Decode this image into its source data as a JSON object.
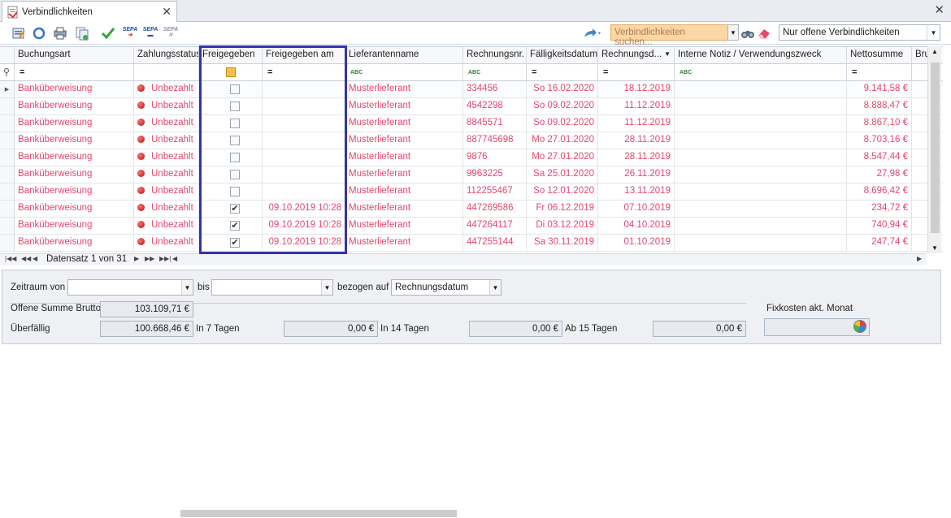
{
  "tab": {
    "title": "Verbindlichkeiten"
  },
  "toolbar": {
    "sepa1": "SEPA",
    "sepa2": "SEPA",
    "sepa3": "SEPA",
    "search_placeholder": "Verbindlichkeiten suchen...",
    "filter_value": "Nur offene Verbindlichkeiten"
  },
  "columns": [
    "Buchungsart",
    "Zahlungsstatus",
    "Freigegeben",
    "Freigegeben am",
    "Lieferantenname",
    "Rechnungsnr.",
    "Fälligkeitsdatum",
    "Rechnungsd...",
    "Interne Notiz / Verwendungszweck",
    "Nettosumme",
    "Brutto"
  ],
  "filter_row": {
    "eq": "=",
    "abc": "ABC"
  },
  "rows": [
    {
      "buchungsart": "Banküberweisung",
      "status": "Unbezahlt",
      "freigegeben": false,
      "freigegeben_am": "",
      "lieferant": "Musterlieferant",
      "rechnungsnr": "334456",
      "faellig": "So 16.02.2020",
      "rechnungsdatum": "18.12.2019",
      "notiz": "",
      "netto": "9.141,58 €"
    },
    {
      "buchungsart": "Banküberweisung",
      "status": "Unbezahlt",
      "freigegeben": false,
      "freigegeben_am": "",
      "lieferant": "Musterlieferant",
      "rechnungsnr": "4542298",
      "faellig": "So 09.02.2020",
      "rechnungsdatum": "11.12.2019",
      "notiz": "",
      "netto": "8.888,47 €"
    },
    {
      "buchungsart": "Banküberweisung",
      "status": "Unbezahlt",
      "freigegeben": false,
      "freigegeben_am": "",
      "lieferant": "Musterlieferant",
      "rechnungsnr": "8845571",
      "faellig": "So 09.02.2020",
      "rechnungsdatum": "11.12.2019",
      "notiz": "",
      "netto": "8.867,10 €"
    },
    {
      "buchungsart": "Banküberweisung",
      "status": "Unbezahlt",
      "freigegeben": false,
      "freigegeben_am": "",
      "lieferant": "Musterlieferant",
      "rechnungsnr": "887745698",
      "faellig": "Mo 27.01.2020",
      "rechnungsdatum": "28.11.2019",
      "notiz": "",
      "netto": "8.703,16 €"
    },
    {
      "buchungsart": "Banküberweisung",
      "status": "Unbezahlt",
      "freigegeben": false,
      "freigegeben_am": "",
      "lieferant": "Musterlieferant",
      "rechnungsnr": "9876",
      "faellig": "Mo 27.01.2020",
      "rechnungsdatum": "28.11.2019",
      "notiz": "",
      "netto": "8.547,44 €"
    },
    {
      "buchungsart": "Banküberweisung",
      "status": "Unbezahlt",
      "freigegeben": false,
      "freigegeben_am": "",
      "lieferant": "Musterlieferant",
      "rechnungsnr": "9963225",
      "faellig": "Sa 25.01.2020",
      "rechnungsdatum": "26.11.2019",
      "notiz": "",
      "netto": "27,98 €"
    },
    {
      "buchungsart": "Banküberweisung",
      "status": "Unbezahlt",
      "freigegeben": false,
      "freigegeben_am": "",
      "lieferant": "Musterlieferant",
      "rechnungsnr": "112255467",
      "faellig": "So 12.01.2020",
      "rechnungsdatum": "13.11.2019",
      "notiz": "",
      "netto": "8.696,42 €"
    },
    {
      "buchungsart": "Banküberweisung",
      "status": "Unbezahlt",
      "freigegeben": true,
      "freigegeben_am": "09.10.2019 10:28",
      "lieferant": "Musterlieferant",
      "rechnungsnr": "447269586",
      "faellig": "Fr 06.12.2019",
      "rechnungsdatum": "07.10.2019",
      "notiz": "",
      "netto": "234,72 €"
    },
    {
      "buchungsart": "Banküberweisung",
      "status": "Unbezahlt",
      "freigegeben": true,
      "freigegeben_am": "09.10.2019 10:28",
      "lieferant": "Musterlieferant",
      "rechnungsnr": "447264117",
      "faellig": "Di 03.12.2019",
      "rechnungsdatum": "04.10.2019",
      "notiz": "",
      "netto": "740,94 €"
    },
    {
      "buchungsart": "Banküberweisung",
      "status": "Unbezahlt",
      "freigegeben": true,
      "freigegeben_am": "09.10.2019 10:28",
      "lieferant": "Musterlieferant",
      "rechnungsnr": "447255144",
      "faellig": "Sa 30.11.2019",
      "rechnungsdatum": "01.10.2019",
      "notiz": "",
      "netto": "247,74 €"
    }
  ],
  "navigator": {
    "record_text": "Datensatz 1 von 31"
  },
  "footer": {
    "zeitraum_label": "Zeitraum von",
    "bis_label": "bis",
    "bezogen_label": "bezogen auf",
    "bezogen_value": "Rechnungsdatum",
    "offene_label": "Offene Summe Brutto",
    "offene_value": "103.109,71 €",
    "ueberfaellig_label": "Überfällig",
    "ueberfaellig_value": "100.668,46 €",
    "in7_label": "In 7 Tagen",
    "in7_value": "0,00 €",
    "in14_label": "In 14 Tagen",
    "in14_value": "0,00 €",
    "ab15_label": "Ab 15 Tagen",
    "ab15_value": "0,00 €",
    "fixkosten_label": "Fixkosten akt. Monat"
  }
}
